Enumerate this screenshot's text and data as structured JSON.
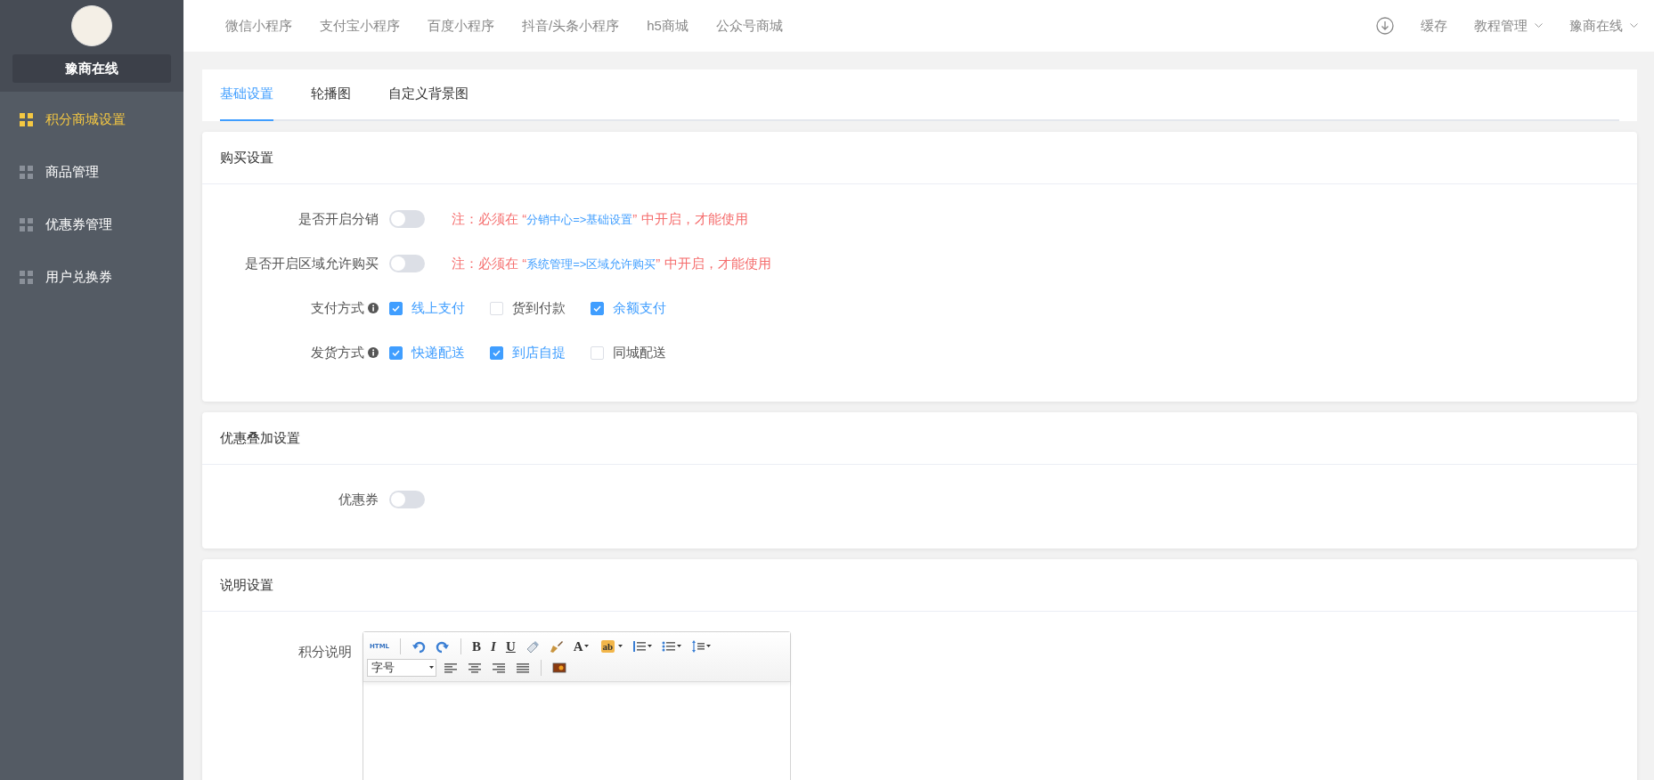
{
  "sidebar": {
    "brand": "豫商在线",
    "items": [
      {
        "label": "积分商城设置",
        "selected": true
      },
      {
        "label": "商品管理",
        "selected": false
      },
      {
        "label": "优惠券管理",
        "selected": false
      },
      {
        "label": "用户兑换券",
        "selected": false
      }
    ]
  },
  "topbar": {
    "nav": [
      "微信小程序",
      "支付宝小程序",
      "百度小程序",
      "抖音/头条小程序",
      "h5商城",
      "公众号商城"
    ],
    "actions": [
      {
        "label": "缓存",
        "dropdown": false
      },
      {
        "label": "教程管理",
        "dropdown": true
      },
      {
        "label": "豫商在线",
        "dropdown": true
      }
    ]
  },
  "tabs": [
    {
      "label": "基础设置",
      "selected": true
    },
    {
      "label": "轮播图",
      "selected": false
    },
    {
      "label": "自定义背景图",
      "selected": false
    }
  ],
  "sections": [
    {
      "title": "购买设置",
      "rows": [
        {
          "kind": "switch",
          "label": "是否开启分销",
          "on": false,
          "note": {
            "prefix": "注：必须在 “",
            "link": "分销中心=>基础设置",
            "suffix": "” 中开启，才能使用"
          }
        },
        {
          "kind": "switch",
          "label": "是否开启区域允许购买",
          "on": false,
          "note": {
            "prefix": "注：必须在 “",
            "link": "系统管理=>区域允许购买",
            "suffix": "” 中开启，才能使用"
          }
        },
        {
          "kind": "checkboxes",
          "label": "支付方式",
          "options": [
            {
              "label": "线上支付",
              "checked": true
            },
            {
              "label": "货到付款",
              "checked": false
            },
            {
              "label": "余额支付",
              "checked": true
            }
          ]
        },
        {
          "kind": "checkboxes",
          "label": "发货方式",
          "options": [
            {
              "label": "快递配送",
              "checked": true
            },
            {
              "label": "到店自提",
              "checked": true
            },
            {
              "label": "同城配送",
              "checked": false
            }
          ]
        }
      ]
    },
    {
      "title": "优惠叠加设置",
      "rows": [
        {
          "kind": "switch",
          "label": "优惠券",
          "on": false
        }
      ]
    },
    {
      "title": "说明设置",
      "rows": [
        {
          "kind": "editor",
          "label": "积分说明",
          "font_size_select": "字号",
          "toolbar": [
            [
              {
                "kind": "html",
                "label": "HTML",
                "dropdown": false
              },
              {
                "kind": "sep"
              },
              {
                "kind": "undo",
                "dropdown": false
              },
              {
                "kind": "redo",
                "dropdown": false
              },
              {
                "kind": "sep"
              },
              {
                "kind": "bold",
                "label": "B",
                "dropdown": false
              },
              {
                "kind": "italic",
                "label": "I",
                "dropdown": false
              },
              {
                "kind": "underline",
                "label": "U",
                "dropdown": false
              },
              {
                "kind": "eraser",
                "dropdown": false
              },
              {
                "kind": "brush",
                "dropdown": false
              },
              {
                "kind": "fontcolor",
                "label": "A",
                "dropdown": true
              },
              {
                "kind": "highlight",
                "label": "ab",
                "dropdown": true
              },
              {
                "kind": "ol",
                "dropdown": true
              },
              {
                "kind": "ul",
                "dropdown": true
              },
              {
                "kind": "lineheight",
                "dropdown": true
              }
            ],
            [
              {
                "kind": "fontsize"
              },
              {
                "kind": "align-left",
                "dropdown": false
              },
              {
                "kind": "align-center",
                "dropdown": false
              },
              {
                "kind": "align-right",
                "dropdown": false
              },
              {
                "kind": "justify",
                "dropdown": false
              },
              {
                "kind": "sep"
              },
              {
                "kind": "image",
                "dropdown": false
              }
            ]
          ]
        }
      ]
    }
  ]
}
